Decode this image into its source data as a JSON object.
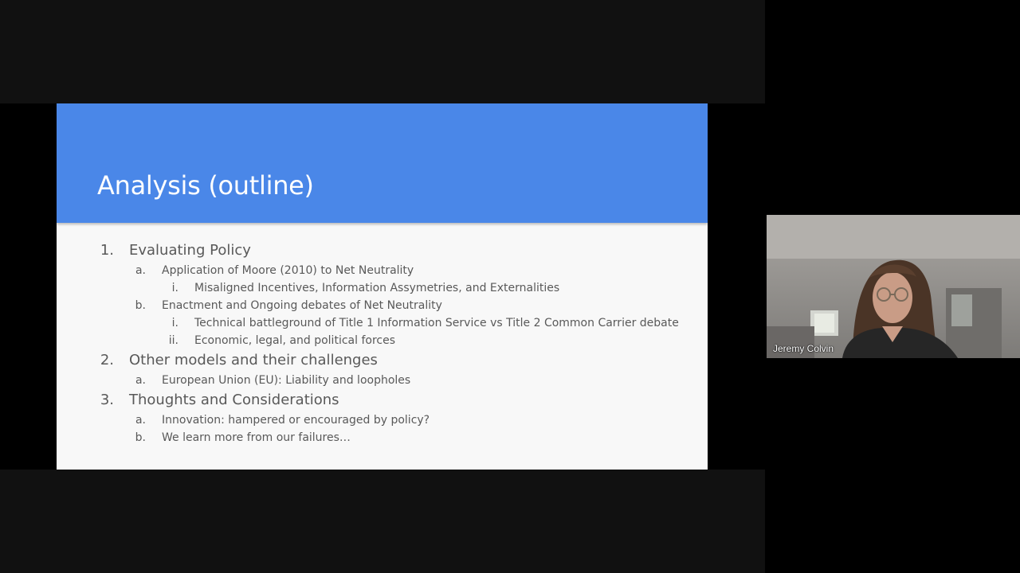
{
  "slide": {
    "title": "Analysis (outline)",
    "outline": [
      {
        "level": 1,
        "marker": "1.",
        "text": "Evaluating Policy"
      },
      {
        "level": 2,
        "marker": "a.",
        "text": "Application of Moore (2010) to Net Neutrality"
      },
      {
        "level": 3,
        "marker": "i.",
        "text": "Misaligned Incentives, Information Assymetries, and Externalities"
      },
      {
        "level": 2,
        "marker": "b.",
        "text": "Enactment and Ongoing debates of Net Neutrality"
      },
      {
        "level": 3,
        "marker": "i.",
        "text": "Technical battleground of Title 1 Information Service vs Title 2 Common Carrier debate"
      },
      {
        "level": 3,
        "marker": "ii.",
        "text": "Economic, legal, and political forces"
      },
      {
        "level": 1,
        "marker": "2.",
        "text": "Other models and their challenges"
      },
      {
        "level": 2,
        "marker": "a.",
        "text": "European Union (EU): Liability and loopholes"
      },
      {
        "level": 1,
        "marker": "3.",
        "text": "Thoughts and Considerations"
      },
      {
        "level": 2,
        "marker": "a.",
        "text": "Innovation: hampered or encouraged by policy?"
      },
      {
        "level": 2,
        "marker": "b.",
        "text": "We learn more from our failures…"
      }
    ]
  },
  "participant": {
    "name": "Jeremy Colvin"
  },
  "colors": {
    "slide_header": "#4a87e8",
    "slide_body": "#f8f8f8",
    "outline_text": "#595959"
  }
}
